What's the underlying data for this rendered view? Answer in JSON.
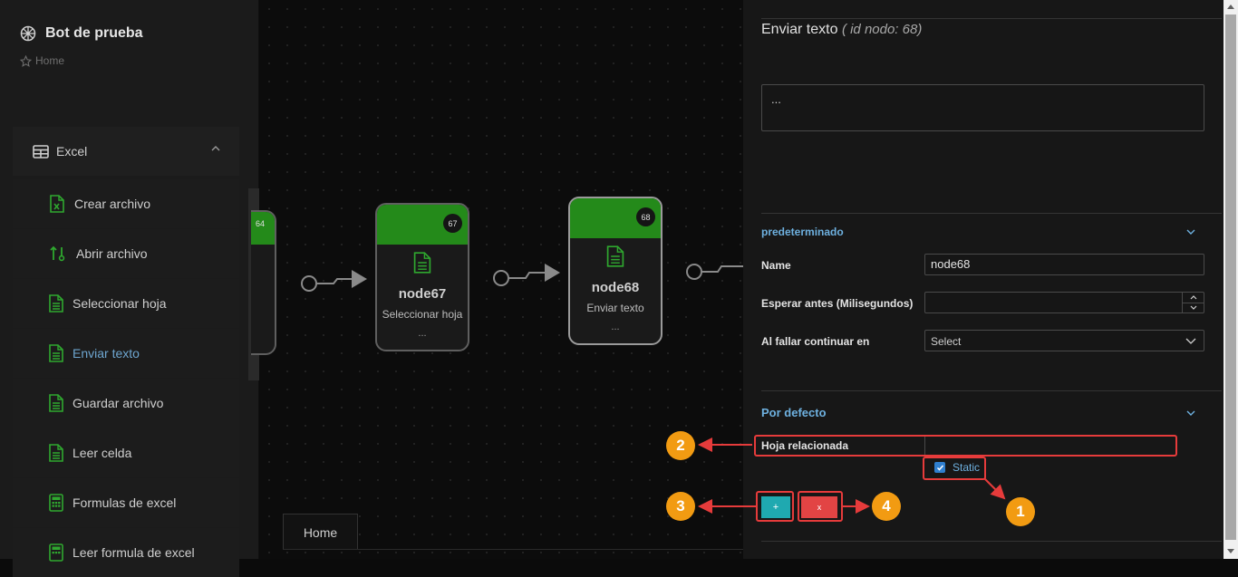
{
  "sidebar": {
    "bot_title": "Bot de prueba",
    "breadcrumb": "Home",
    "group_label": "Excel",
    "items": [
      {
        "label": "Crear archivo",
        "icon": "excel-file-icon"
      },
      {
        "label": "Abrir archivo",
        "icon": "sort-arrows-icon"
      },
      {
        "label": "Seleccionar hoja",
        "icon": "document-icon"
      },
      {
        "label": "Enviar texto",
        "icon": "document-icon",
        "active": true
      },
      {
        "label": "Guardar archivo",
        "icon": "document-icon"
      },
      {
        "label": "Leer celda",
        "icon": "document-icon"
      },
      {
        "label": "Formulas de excel",
        "icon": "calculator-icon"
      },
      {
        "label": "Leer formula de excel",
        "icon": "calculator-icon"
      }
    ]
  },
  "canvas": {
    "partial_badge": "64",
    "nodes": [
      {
        "id": "67",
        "name": "node67",
        "desc": "Seleccionar hoja",
        "dots": "..."
      },
      {
        "id": "68",
        "name": "node68",
        "desc": "Enviar texto",
        "dots": "..."
      }
    ],
    "tab_label": "Home"
  },
  "panel": {
    "title": "Enviar texto",
    "title_id": "( id nodo: 68)",
    "textarea_value": "...",
    "section1_title": "predeterminado",
    "name_label": "Name",
    "name_value": "node68",
    "wait_label": "Esperar antes (Milisegundos)",
    "wait_value": "",
    "fail_label": "Al fallar continuar en",
    "fail_placeholder": "Select",
    "section2_title": "Por defecto",
    "sheet_label": "Hoja relacionada",
    "static_label": "Static",
    "add_btn": "+",
    "del_btn": "x"
  },
  "annotations": [
    "1",
    "2",
    "3",
    "4"
  ],
  "colors": {
    "accent": "#248a1a",
    "link": "#6eb1e0",
    "callout": "#f29b12",
    "highlight": "#e63b3b"
  }
}
